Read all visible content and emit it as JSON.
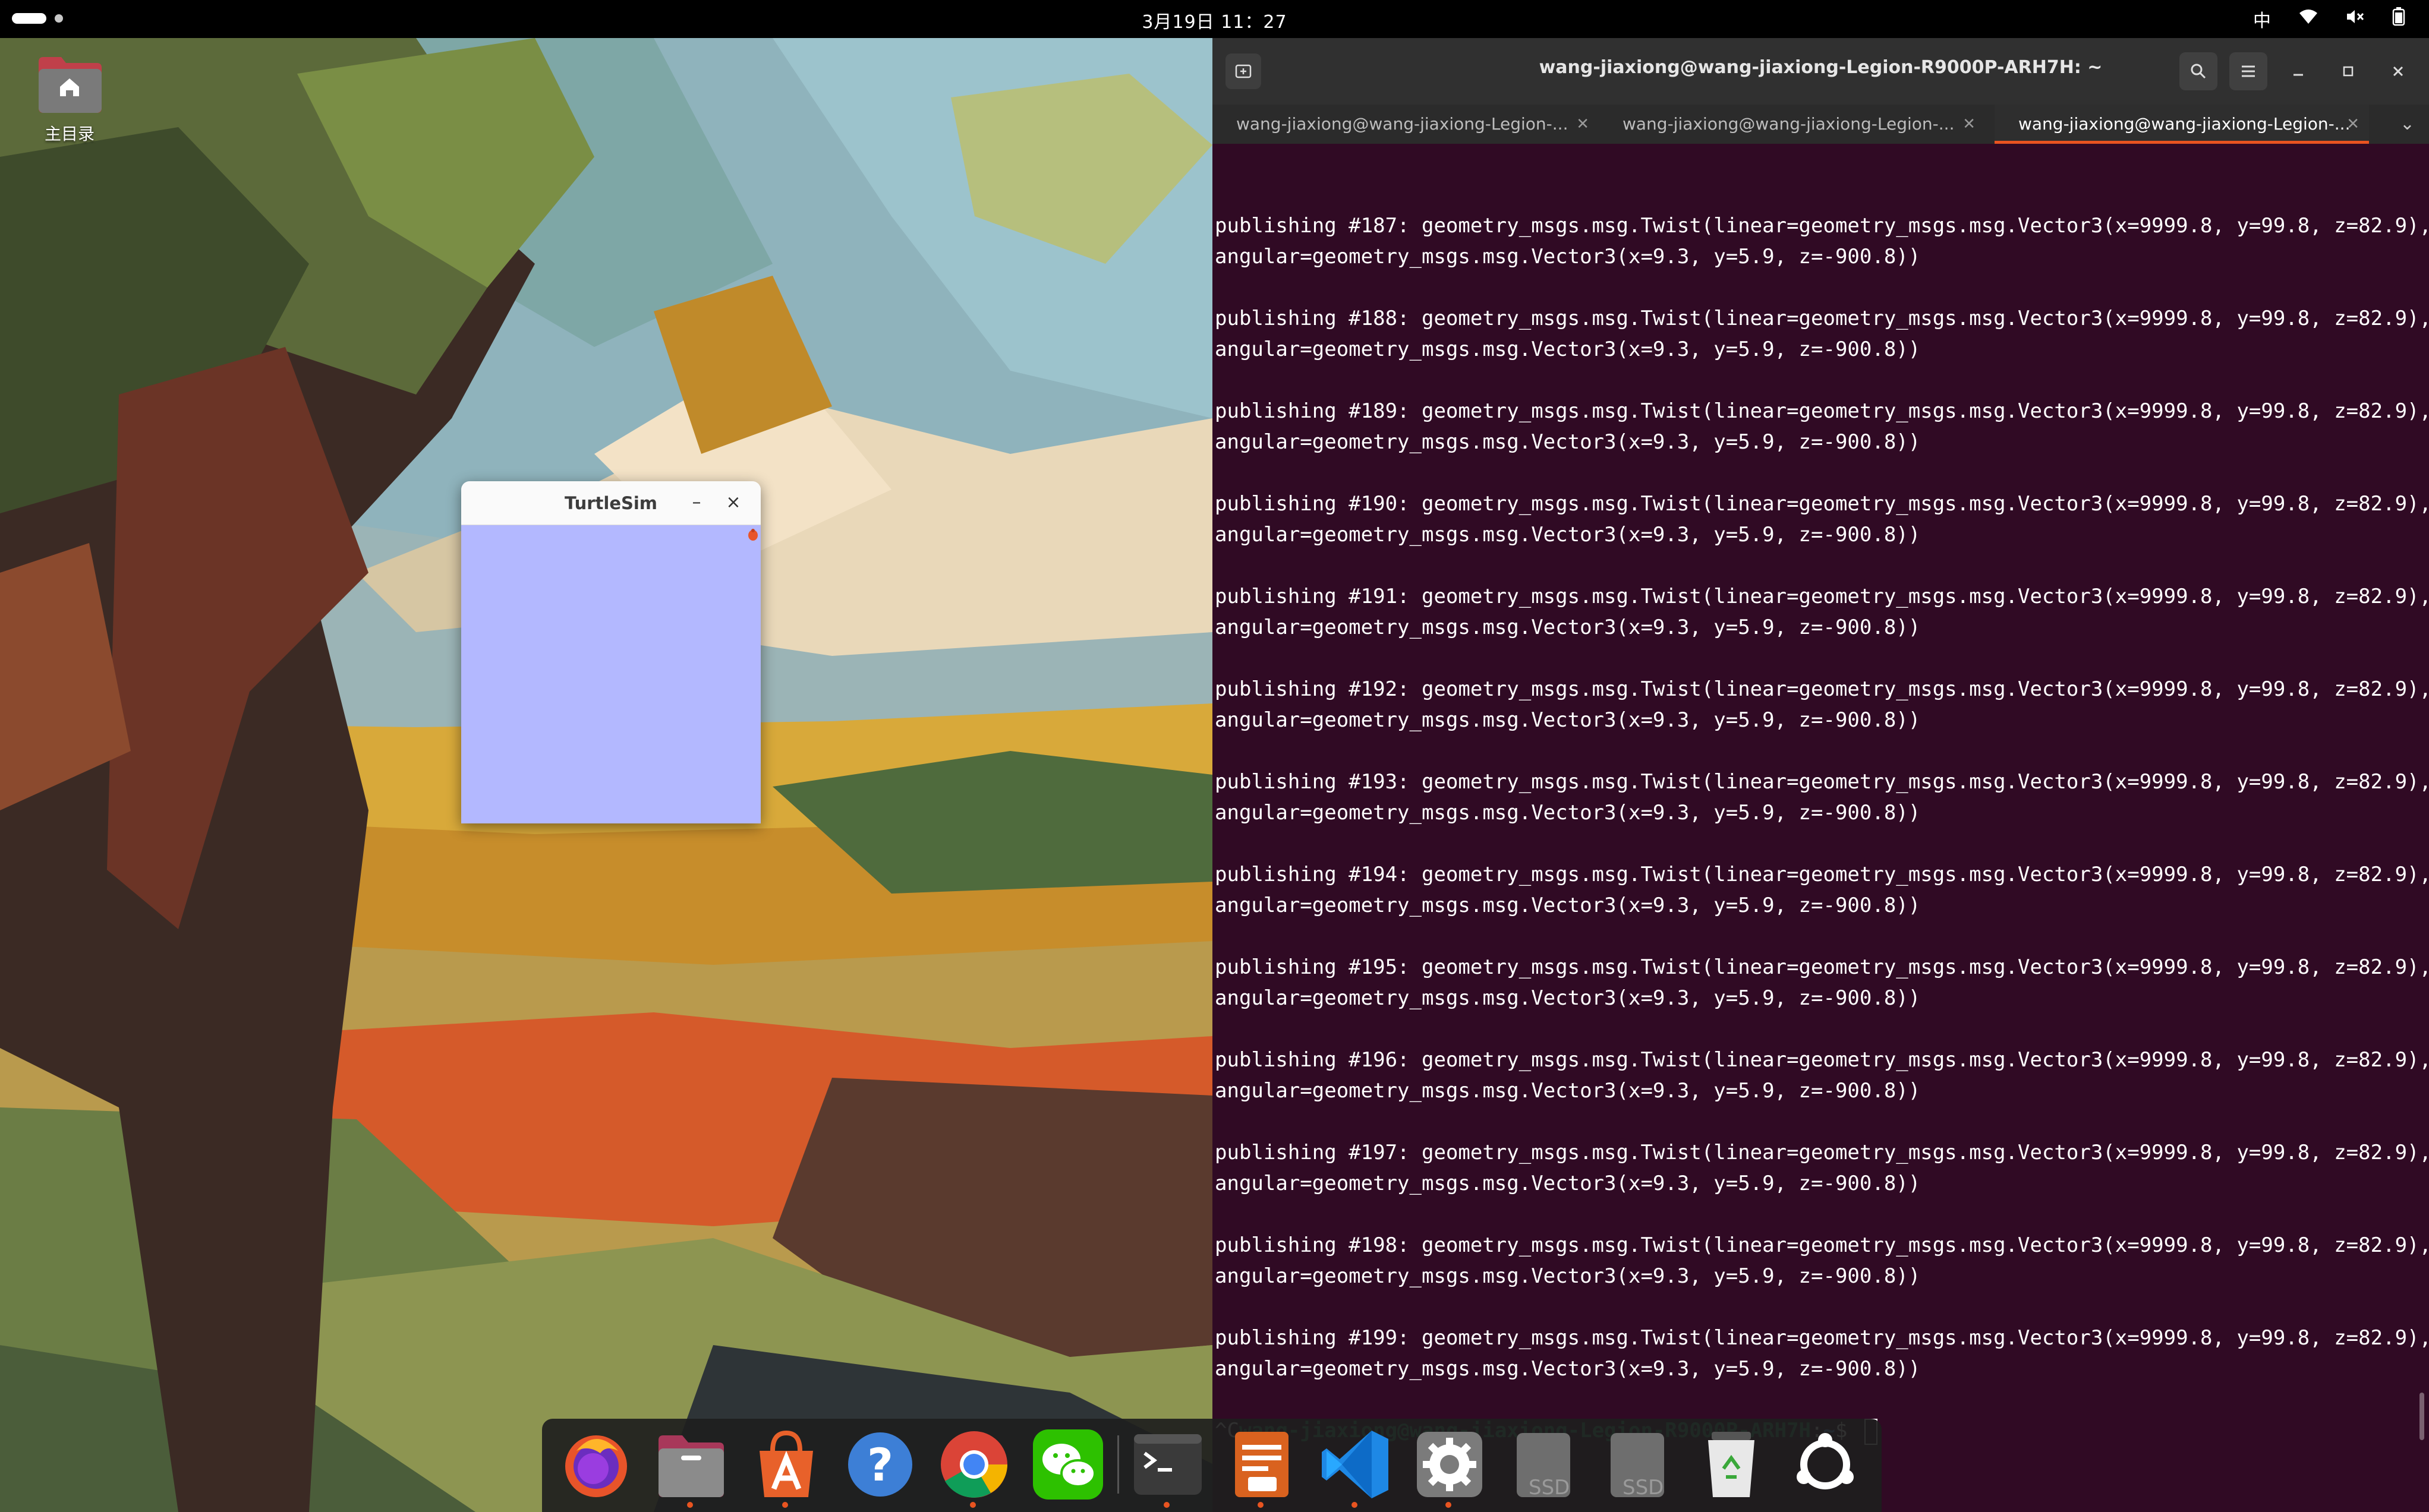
{
  "topbar": {
    "clock": "3月19日 11：27",
    "input_method": "中"
  },
  "desktop": {
    "home_folder_label": "主目录"
  },
  "turtlesim": {
    "title": "TurtleSim",
    "minimize": "–",
    "close": "×",
    "background_color": "#b3b8ff"
  },
  "terminal": {
    "title": "wang-jiaxiong@wang-jiaxiong-Legion-R9000P-ARH7H: ~",
    "tabs": [
      {
        "label": "wang-jiaxiong@wang-jiaxiong-Legion-..."
      },
      {
        "label": "wang-jiaxiong@wang-jiaxiong-Legion-..."
      },
      {
        "label": "wang-jiaxiong@wang-jiaxiong-Legion-..."
      }
    ],
    "active_tab": 2,
    "lines": [
      {
        "a": "publishing #187: geometry_msgs.msg.Twist(linear=geometry_msgs.msg.Vector3(x=9999.8, y=99.8, z=82.9),",
        "b": "angular=geometry_msgs.msg.Vector3(x=9.3, y=5.9, z=-900.8))"
      },
      {
        "a": "publishing #188: geometry_msgs.msg.Twist(linear=geometry_msgs.msg.Vector3(x=9999.8, y=99.8, z=82.9),",
        "b": "angular=geometry_msgs.msg.Vector3(x=9.3, y=5.9, z=-900.8))"
      },
      {
        "a": "publishing #189: geometry_msgs.msg.Twist(linear=geometry_msgs.msg.Vector3(x=9999.8, y=99.8, z=82.9),",
        "b": "angular=geometry_msgs.msg.Vector3(x=9.3, y=5.9, z=-900.8))"
      },
      {
        "a": "publishing #190: geometry_msgs.msg.Twist(linear=geometry_msgs.msg.Vector3(x=9999.8, y=99.8, z=82.9),",
        "b": "angular=geometry_msgs.msg.Vector3(x=9.3, y=5.9, z=-900.8))"
      },
      {
        "a": "publishing #191: geometry_msgs.msg.Twist(linear=geometry_msgs.msg.Vector3(x=9999.8, y=99.8, z=82.9),",
        "b": "angular=geometry_msgs.msg.Vector3(x=9.3, y=5.9, z=-900.8))"
      },
      {
        "a": "publishing #192: geometry_msgs.msg.Twist(linear=geometry_msgs.msg.Vector3(x=9999.8, y=99.8, z=82.9),",
        "b": "angular=geometry_msgs.msg.Vector3(x=9.3, y=5.9, z=-900.8))"
      },
      {
        "a": "publishing #193: geometry_msgs.msg.Twist(linear=geometry_msgs.msg.Vector3(x=9999.8, y=99.8, z=82.9),",
        "b": "angular=geometry_msgs.msg.Vector3(x=9.3, y=5.9, z=-900.8))"
      },
      {
        "a": "publishing #194: geometry_msgs.msg.Twist(linear=geometry_msgs.msg.Vector3(x=9999.8, y=99.8, z=82.9),",
        "b": "angular=geometry_msgs.msg.Vector3(x=9.3, y=5.9, z=-900.8))"
      },
      {
        "a": "publishing #195: geometry_msgs.msg.Twist(linear=geometry_msgs.msg.Vector3(x=9999.8, y=99.8, z=82.9),",
        "b": "angular=geometry_msgs.msg.Vector3(x=9.3, y=5.9, z=-900.8))"
      },
      {
        "a": "publishing #196: geometry_msgs.msg.Twist(linear=geometry_msgs.msg.Vector3(x=9999.8, y=99.8, z=82.9),",
        "b": "angular=geometry_msgs.msg.Vector3(x=9.3, y=5.9, z=-900.8))"
      },
      {
        "a": "publishing #197: geometry_msgs.msg.Twist(linear=geometry_msgs.msg.Vector3(x=9999.8, y=99.8, z=82.9),",
        "b": "angular=geometry_msgs.msg.Vector3(x=9.3, y=5.9, z=-900.8))"
      },
      {
        "a": "publishing #198: geometry_msgs.msg.Twist(linear=geometry_msgs.msg.Vector3(x=9999.8, y=99.8, z=82.9),",
        "b": "angular=geometry_msgs.msg.Vector3(x=9.3, y=5.9, z=-900.8))"
      },
      {
        "a": "publishing #199: geometry_msgs.msg.Twist(linear=geometry_msgs.msg.Vector3(x=9999.8, y=99.8, z=82.9),",
        "b": "angular=geometry_msgs.msg.Vector3(x=9.3, y=5.9, z=-900.8))"
      }
    ],
    "prompt": {
      "interrupt": "^C",
      "user_host": "wang-jiaxiong@wang-jiaxiong-Legion-R9000P-ARH7H",
      "colon": ":",
      "path": "~",
      "symbol": "$ "
    },
    "colors": {
      "background": "#300a24",
      "prompt_user": "#26a269",
      "prompt_path": "#5a9be0",
      "accent": "#e95420"
    }
  },
  "dock": {
    "items": [
      {
        "name": "firefox-icon",
        "running": false
      },
      {
        "name": "files-icon",
        "running": true
      },
      {
        "name": "app-center-icon",
        "running": true
      },
      {
        "name": "help-icon",
        "running": false
      },
      {
        "name": "chrome-icon",
        "running": true
      },
      {
        "name": "wechat-icon",
        "running": false
      },
      {
        "name": "terminal-icon",
        "running": true
      },
      {
        "name": "text-editor-icon",
        "running": true
      },
      {
        "name": "vscode-icon",
        "running": true
      },
      {
        "name": "settings-icon",
        "running": true
      },
      {
        "name": "ssd-drive-icon",
        "running": false
      },
      {
        "name": "ssd-drive-icon",
        "running": false
      },
      {
        "name": "trash-icon",
        "running": false
      },
      {
        "name": "show-apps-icon",
        "running": false
      }
    ],
    "ssd_label": "SSD"
  }
}
